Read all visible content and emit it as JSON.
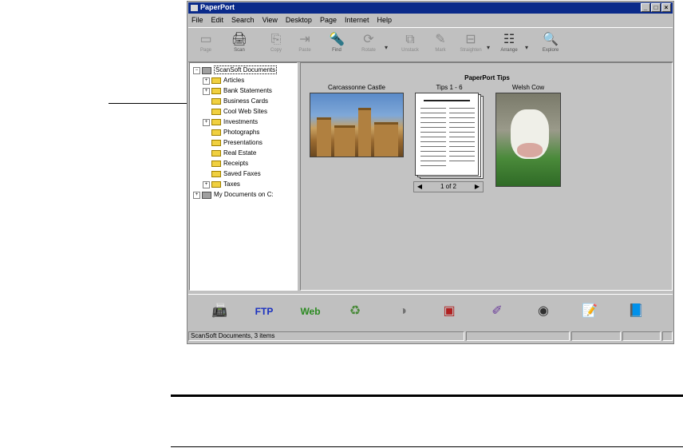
{
  "window": {
    "title": "PaperPort",
    "controls": [
      "_",
      "□",
      "×"
    ]
  },
  "menu": [
    "File",
    "Edit",
    "Search",
    "View",
    "Desktop",
    "Page",
    "Internet",
    "Help"
  ],
  "toolbar": [
    {
      "label": "Page",
      "icon": "page-icon",
      "glyph": "▭",
      "enabled": false
    },
    {
      "label": "Scan",
      "icon": "scanner-icon",
      "glyph": "🖨",
      "enabled": true
    },
    {
      "label": "Copy",
      "icon": "copy-icon",
      "glyph": "⎘",
      "enabled": false
    },
    {
      "label": "Paste",
      "icon": "paste-icon",
      "glyph": "⇥",
      "enabled": false
    },
    {
      "label": "Find",
      "icon": "find-icon",
      "glyph": "🔦",
      "enabled": true
    },
    {
      "label": "Rotate",
      "icon": "rotate-icon",
      "glyph": "⟳",
      "enabled": false
    },
    {
      "label": "Unstack",
      "icon": "unstack-icon",
      "glyph": "⧉",
      "enabled": false
    },
    {
      "label": "Mark",
      "icon": "mark-icon",
      "glyph": "✎",
      "enabled": false
    },
    {
      "label": "Straighten",
      "icon": "straighten-icon",
      "glyph": "⊟",
      "enabled": false
    },
    {
      "label": "Arrange",
      "icon": "arrange-icon",
      "glyph": "☷",
      "enabled": true
    },
    {
      "label": "Explore",
      "icon": "explore-icon",
      "glyph": "🔍",
      "enabled": true
    }
  ],
  "tree": [
    {
      "label": "ScanSoft Documents",
      "type": "drive",
      "level": 0,
      "expander": "−",
      "selected": true
    },
    {
      "label": "Articles",
      "type": "folder",
      "level": 1,
      "expander": "+"
    },
    {
      "label": "Bank Statements",
      "type": "folder",
      "level": 1,
      "expander": "+"
    },
    {
      "label": "Business Cards",
      "type": "folder",
      "level": 1,
      "expander": ""
    },
    {
      "label": "Cool Web Sites",
      "type": "folder",
      "level": 1,
      "expander": ""
    },
    {
      "label": "Investments",
      "type": "folder",
      "level": 1,
      "expander": "+"
    },
    {
      "label": "Photographs",
      "type": "folder",
      "level": 1,
      "expander": ""
    },
    {
      "label": "Presentations",
      "type": "folder",
      "level": 1,
      "expander": ""
    },
    {
      "label": "Real Estate",
      "type": "folder",
      "level": 1,
      "expander": ""
    },
    {
      "label": "Receipts",
      "type": "folder",
      "level": 1,
      "expander": ""
    },
    {
      "label": "Saved Faxes",
      "type": "folder",
      "level": 1,
      "expander": ""
    },
    {
      "label": "Taxes",
      "type": "folder",
      "level": 1,
      "expander": "+"
    },
    {
      "label": "My Documents on C:",
      "type": "drive",
      "level": 0,
      "expander": "+"
    }
  ],
  "desktop": {
    "stack_title": "PaperPort Tips",
    "items": [
      {
        "caption": "Carcassonne Castle"
      },
      {
        "caption": "Tips 1 - 6"
      },
      {
        "caption": "Welsh Cow"
      }
    ],
    "pager": {
      "prev": "◀",
      "text": "1 of 2",
      "next": "▶"
    }
  },
  "sendto_bar": [
    {
      "icon": "fax-icon",
      "glyph": "📠",
      "color": "#2a8aa0"
    },
    {
      "icon": "ftp-icon",
      "glyph": "FTP",
      "color": "#1a30c0"
    },
    {
      "icon": "web-icon",
      "glyph": "Web",
      "color": "#2a8a20"
    },
    {
      "icon": "recycle-bin-icon",
      "glyph": "♻",
      "color": "#4a8a3a"
    },
    {
      "icon": "ocr-icon",
      "glyph": "◑",
      "color": "#707070"
    },
    {
      "icon": "photo-editor-icon",
      "glyph": "▣",
      "color": "#b02020"
    },
    {
      "icon": "art-tools-icon",
      "glyph": "✐",
      "color": "#6a3a9a"
    },
    {
      "icon": "camera-icon",
      "glyph": "◉",
      "color": "#303030"
    },
    {
      "icon": "word-processor-icon",
      "glyph": "📝",
      "color": "#2a4aa0"
    },
    {
      "icon": "notebook-icon",
      "glyph": "📘",
      "color": "#2a9a9a"
    }
  ],
  "status": {
    "text": "ScanSoft Documents, 3 items"
  }
}
